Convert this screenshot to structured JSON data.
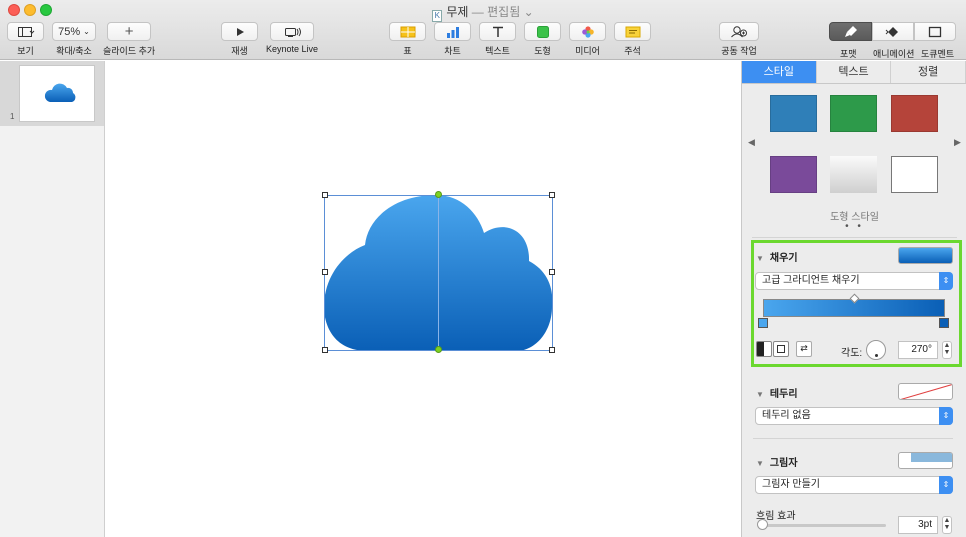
{
  "window": {
    "title": "무제",
    "separator": " — ",
    "status": "편집됨",
    "title_chevron": "⌄"
  },
  "toolbar": {
    "view_label": "보기",
    "zoom_value": "75%",
    "zoom_label": "확대/축소",
    "add_slide_label": "슬라이드 추가",
    "play_label": "재생",
    "keynote_live_label": "Keynote Live",
    "table_label": "표",
    "chart_label": "차트",
    "text_label": "텍스트",
    "shape_label": "도형",
    "media_label": "미디어",
    "comment_label": "주석",
    "collaborate_label": "공동 작업",
    "format_label": "포맷",
    "animate_label": "애니메이션",
    "document_label": "도큐멘트"
  },
  "navigator": {
    "slides": [
      {
        "number": "1"
      }
    ]
  },
  "inspector": {
    "tabs": [
      "스타일",
      "텍스트",
      "정렬"
    ],
    "active_tab": "스타일",
    "shape_styles_label": "도형 스타일",
    "page_dots": "• •",
    "swatch_colors": [
      "#2f7fb8",
      "#2d9a4a",
      "#b5443a",
      "#7a4a9a",
      "#e6e6e6",
      "#ffffff"
    ],
    "fill": {
      "title": "채우기",
      "type": "고급 그라디언트 채우기",
      "angle_label": "각도:",
      "angle_value": "270°",
      "gradient_start": "#4aa6ee",
      "gradient_end": "#0a5fb6"
    },
    "border": {
      "title": "테두리",
      "type": "테두리 없음"
    },
    "shadow": {
      "title": "그림자",
      "type": "그림자 만들기"
    },
    "blur": {
      "label": "흐림 효과",
      "value": "3pt"
    }
  }
}
